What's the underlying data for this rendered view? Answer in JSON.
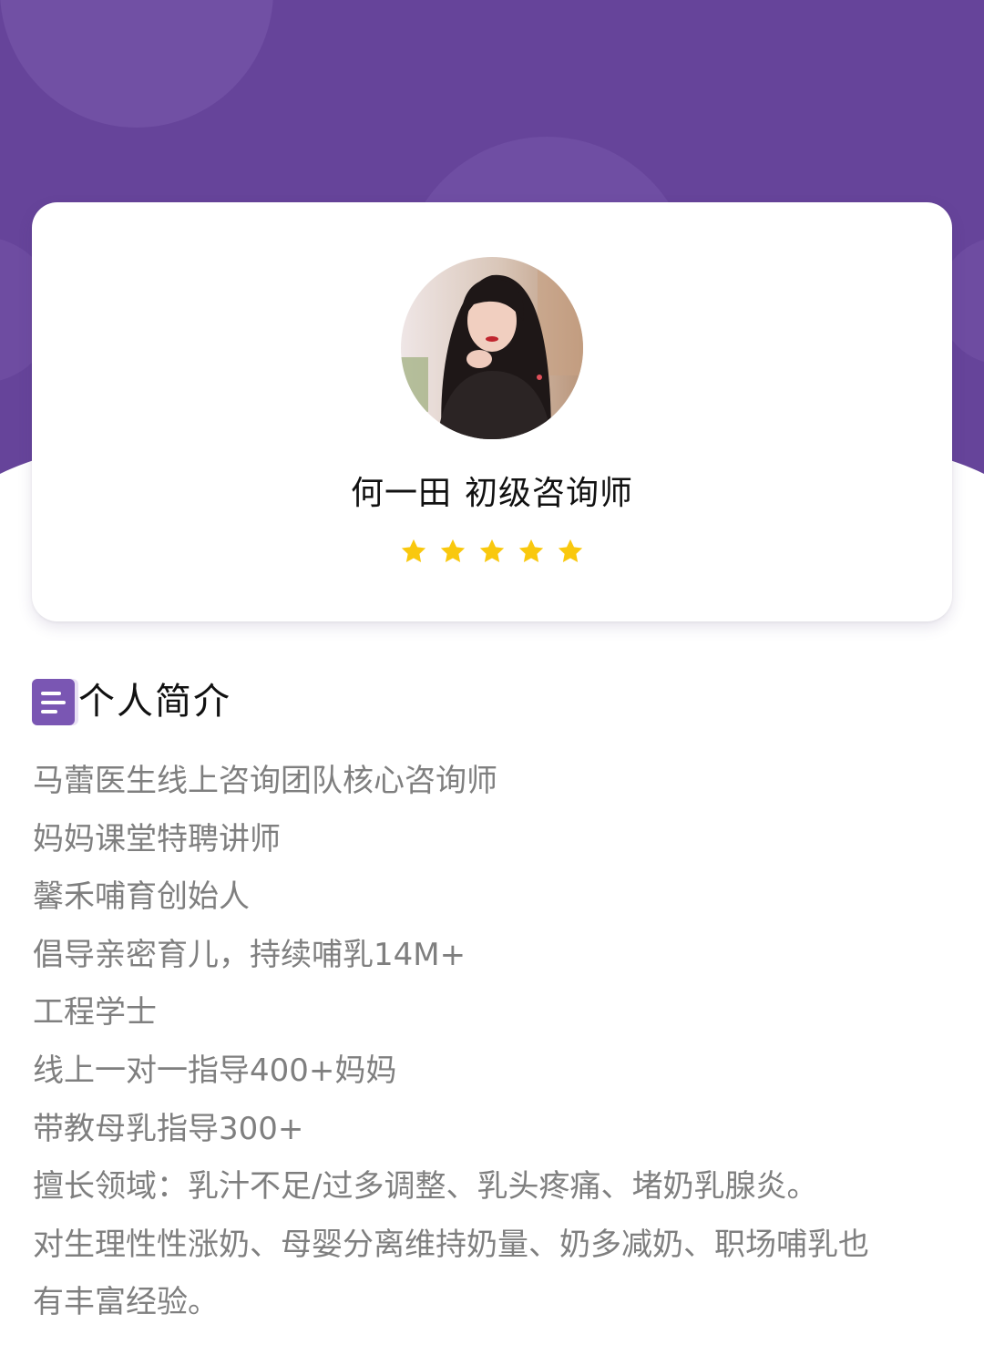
{
  "theme": {
    "header_purple": "#66449a",
    "accent_purple": "#7a56b3",
    "star_color": "#f9c80e",
    "name_color": "#111111",
    "bio_text_color": "#7f7f7f"
  },
  "profile": {
    "name": "何一田",
    "title": "初级咨询师",
    "rating": 5,
    "rating_max": 5,
    "star_icon": "star-icon"
  },
  "intro": {
    "icon": "document-icon",
    "heading": "个人简介",
    "lines": [
      "马蕾医生线上咨询团队核心咨询师",
      "妈妈课堂特聘讲师",
      "馨禾哺育创始人",
      "倡导亲密育儿，持续哺乳14M+",
      "工程学士",
      "线上一对一指导400+妈妈",
      "带教母乳指导300+",
      "擅长领域：乳汁不足/过多调整、乳头疼痛、堵奶乳腺炎。",
      "对生理性性涨奶、母婴分离维持奶量、奶多减奶、职场哺乳也",
      "有丰富经验。"
    ]
  }
}
